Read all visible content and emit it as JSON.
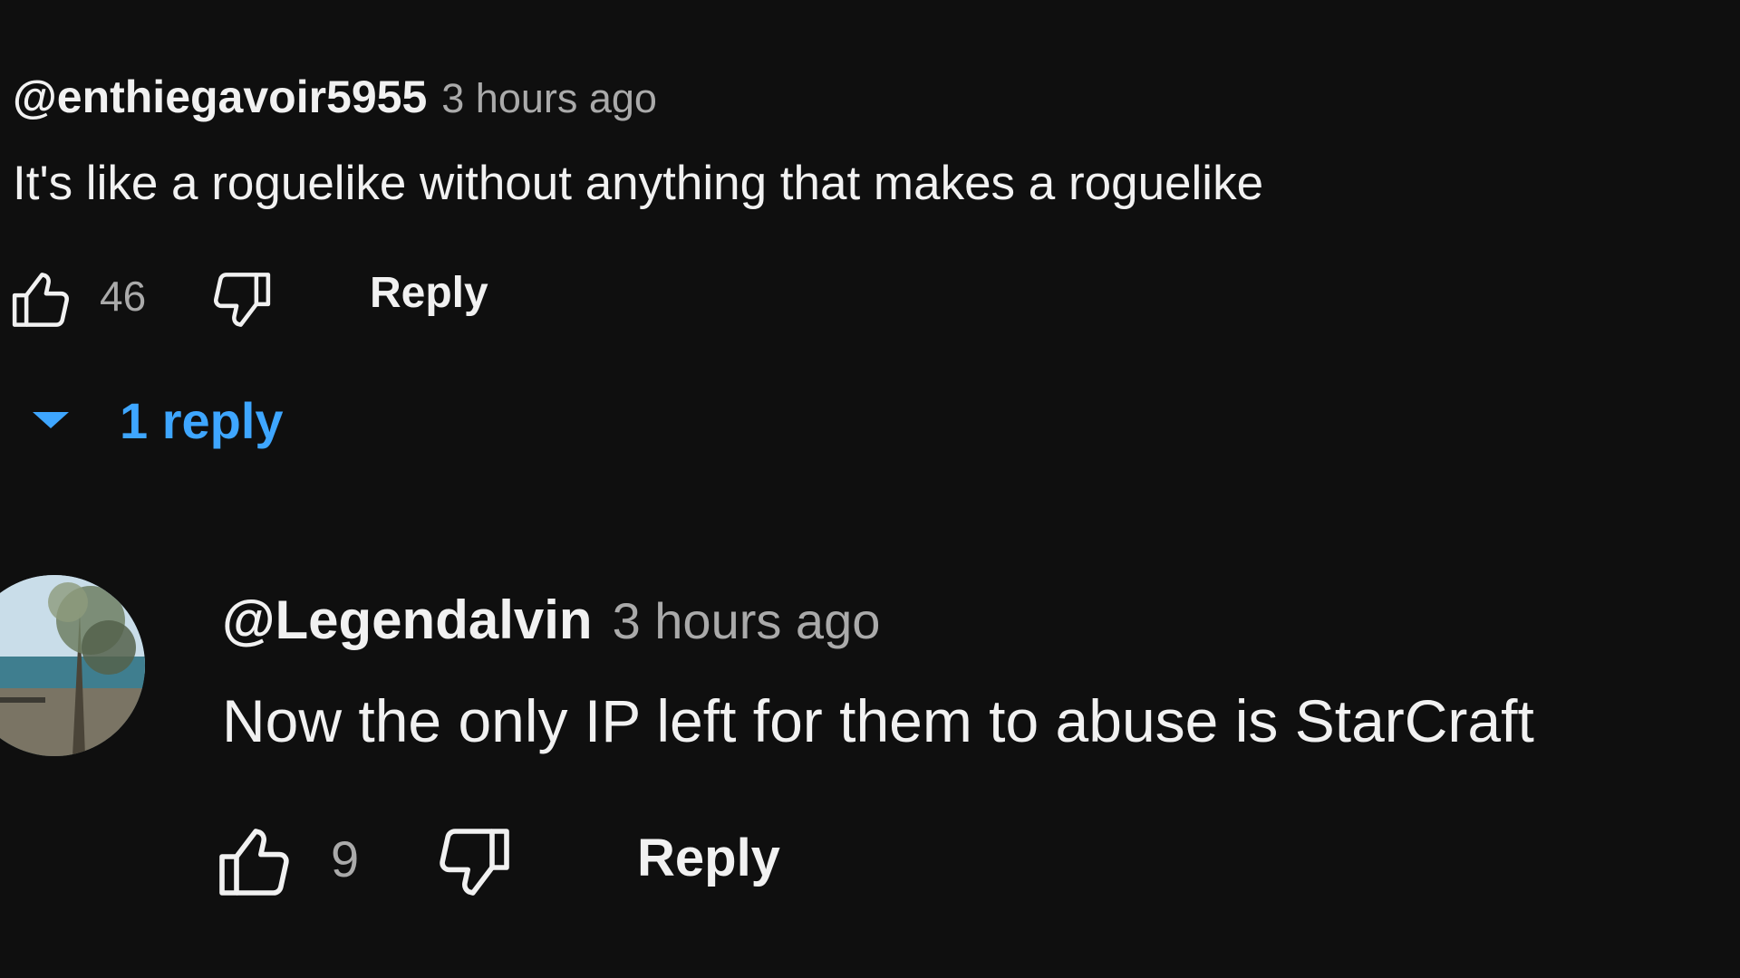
{
  "comments": [
    {
      "author": "@enthiegavoir5955",
      "time": "3 hours ago",
      "text": "It's like a roguelike without anything that makes a roguelike",
      "likes": "46",
      "reply_label": "Reply",
      "replies_toggle": "1 reply"
    },
    {
      "author": "@Legendalvin",
      "time": "3 hours ago",
      "text": "Now the only IP left for them to abuse is StarCraft",
      "likes": "9",
      "reply_label": "Reply"
    }
  ],
  "icons": {
    "like": "thumbs-up-icon",
    "dislike": "thumbs-down-icon",
    "expand": "caret-down-icon"
  },
  "colors": {
    "background": "#0f0f0f",
    "primary_text": "#f1f1f1",
    "secondary_text": "#aaaaaa",
    "link_blue": "#3ea6ff"
  }
}
